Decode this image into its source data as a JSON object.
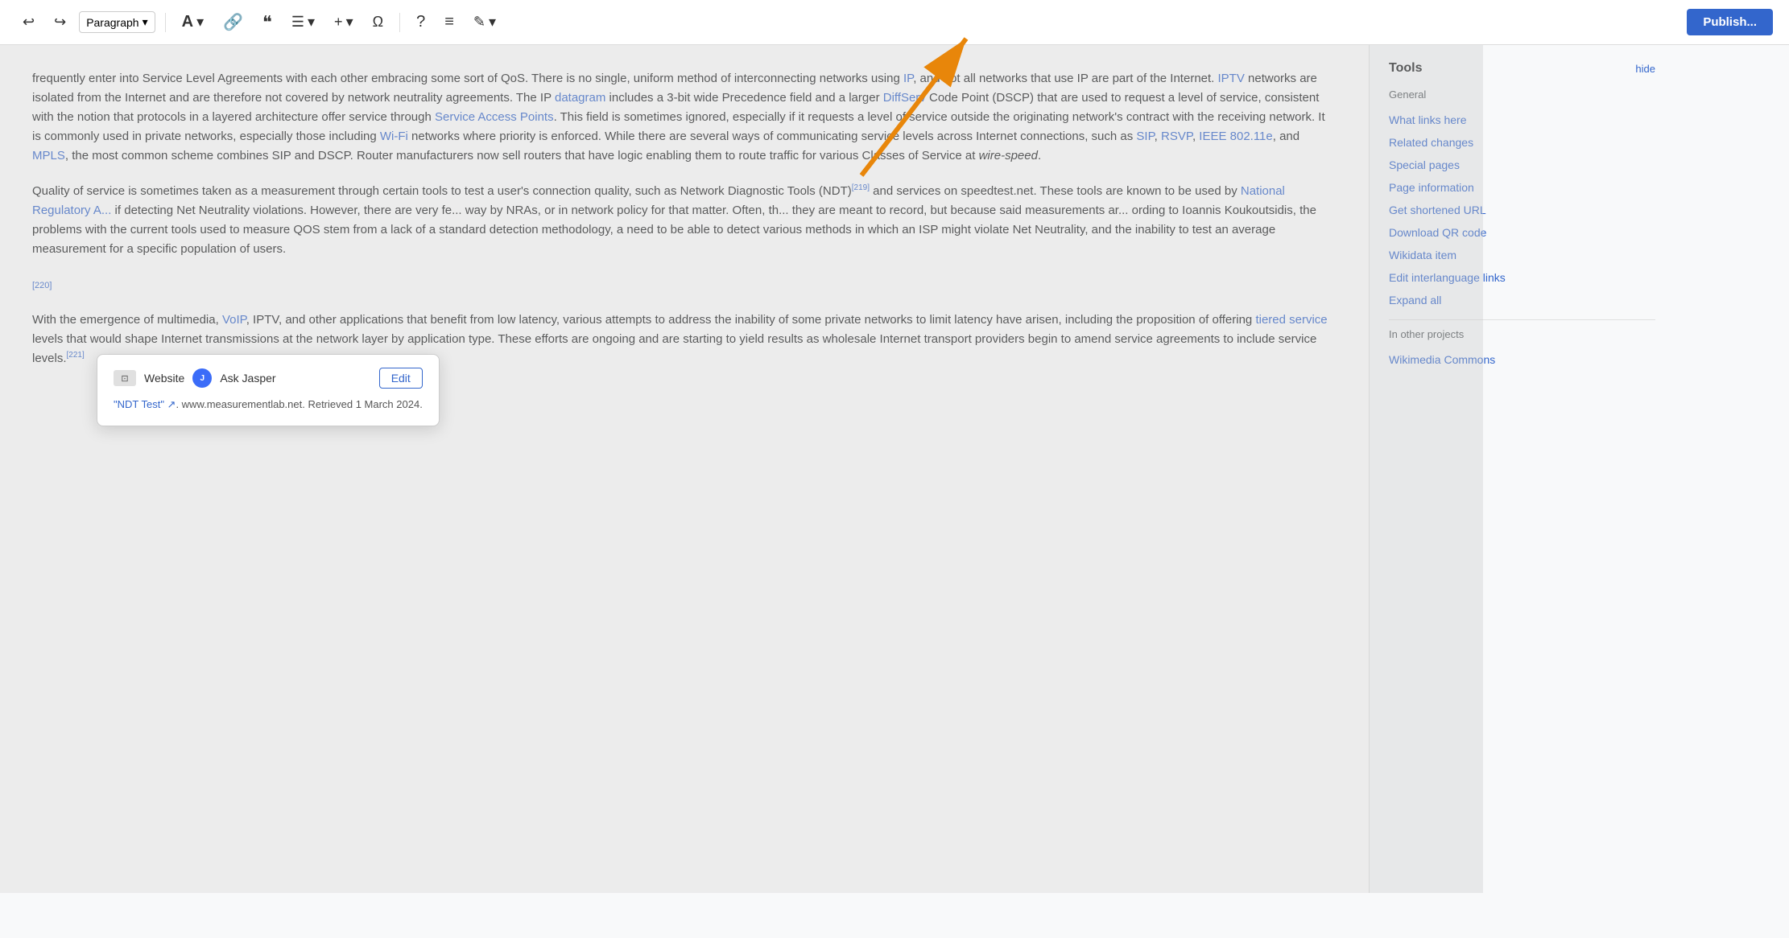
{
  "toolbar": {
    "undo_label": "↩",
    "redo_label": "↪",
    "paragraph_label": "Paragraph",
    "paragraph_arrow": "▾",
    "text_format_label": "A",
    "link_label": "🔗",
    "quote_label": "❝",
    "list_label": "☰",
    "list_arrow": "▾",
    "insert_label": "+",
    "insert_arrow": "▾",
    "special_char_label": "Ω",
    "help_label": "?",
    "menu_label": "≡",
    "edit_pen_label": "✎",
    "publish_label": "Publish..."
  },
  "sidebar": {
    "tools_title": "Tools",
    "hide_label": "hide",
    "general_label": "General",
    "what_links_here": "What links here",
    "related_changes": "Related changes",
    "special_pages": "Special pages",
    "page_information": "Page information",
    "get_shortened_url": "Get shortened URL",
    "download_qr_code": "Download QR code",
    "wikidata_item": "Wikidata item",
    "edit_interlanguage_links": "Edit interlanguage links",
    "expand_all": "Expand all",
    "in_other_projects": "In other projects",
    "wikimedia_commons": "Wikimedia Commons"
  },
  "content": {
    "paragraph1": "frequently enter into Service Level Agreements with each other embracing some sort of QoS. There is no single, uniform method of interconnecting networks using IP, and not all networks that use IP are part of the Internet. IPTV networks are isolated from the Internet and are therefore not covered by network neutrality agreements. The IP datagram includes a 3-bit wide Precedence field and a larger DiffServ Code Point (DSCP) that are used to request a level of service, consistent with the notion that protocols in a layered architecture offer service through Service Access Points. This field is sometimes ignored, especially if it requests a level of service outside the originating network's contract with the receiving network. It is commonly used in private networks, especially those including Wi-Fi networks where priority is enforced. While there are several ways of communicating service levels across Internet connections, such as SIP, RSVP, IEEE 802.11e, and MPLS, the most common scheme combines SIP and DSCP. Router manufacturers now sell routers that have logic enabling them to route traffic for various Classes of Service at wire-speed.",
    "paragraph2": "Quality of service is sometimes taken as a measurement through certain tools to test a user's connection quality, such as Network Diagnostic Tools (NDT)[219] and services on speedtest.net. These tools are known to be used by National Regulatory A... if detecting Net Neutrality violations. However, there are very fe... way by NRAs, or in network policy for that matter. Often, th... they are meant to record, but because said measurements ar... ording to Ioannis Koukoutsidis, the problems with the current tools used to measure QOS stem from a lack of a standard detection methodology, a need to be able to detect various methods in which an ISP might violate Net Neutrality, and the inability to test an average measurement for a specific population of users.",
    "ref220": "[220]",
    "paragraph3": "With the emergence of multimedia, VoIP, IPTV, and other applications that benefit from low latency, various attempts to address the inability of some private networks to limit latency have arisen, including the proposition of offering tiered service levels that would shape Internet transmissions at the network layer by application type. These efforts are ongoing and are starting to yield results as wholesale Internet transport providers begin to amend service agreements to include service levels.[221]"
  },
  "popup": {
    "website_icon_label": "⊡",
    "website_label": "Website",
    "jasper_icon_label": "J",
    "jasper_label": "Ask Jasper",
    "edit_label": "Edit",
    "link_text": "\"NDT Test\" ↗",
    "link_url": "#",
    "source_text": ". www.measurementlab.net. Retrieved 1 March 2024."
  }
}
